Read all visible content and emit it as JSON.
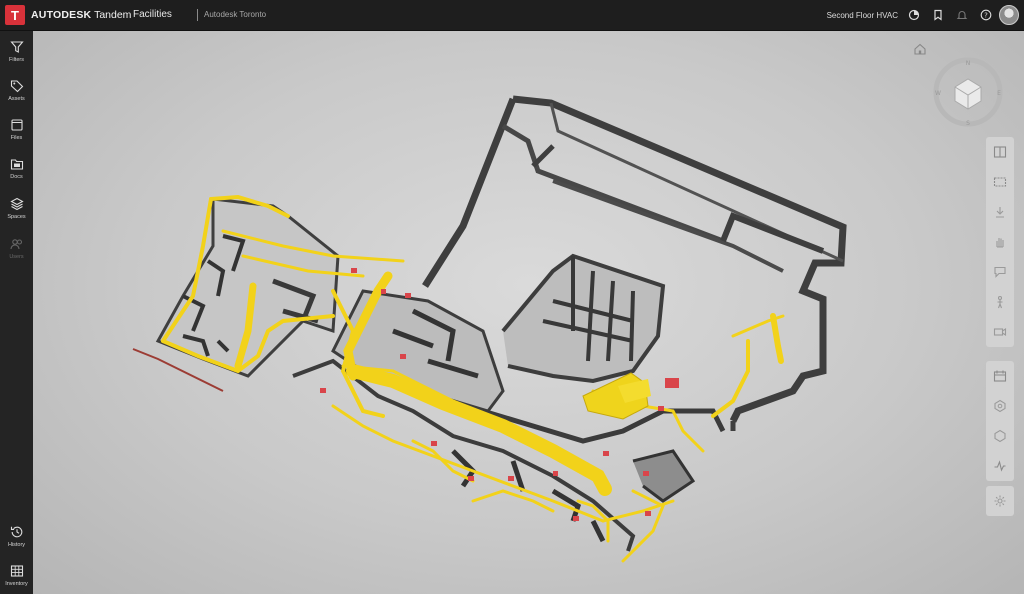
{
  "app": {
    "brand_bold": "AUTODESK",
    "brand_product": "Tandem",
    "logo_letter": "T",
    "module": "Facilities",
    "facility": "Autodesk Toronto",
    "view": "Second Floor HVAC"
  },
  "top_icons": [
    "view-icon",
    "bookmark-icon",
    "notifications-icon",
    "help-icon"
  ],
  "sidebar": {
    "items": [
      {
        "label": "Filters",
        "icon": "filter-icon"
      },
      {
        "label": "Assets",
        "icon": "tag-icon"
      },
      {
        "label": "Files",
        "icon": "folder-icon"
      },
      {
        "label": "Docs",
        "icon": "docs-icon"
      },
      {
        "label": "Spaces",
        "icon": "layers-icon"
      },
      {
        "label": "Users",
        "icon": "users-icon"
      }
    ],
    "bottom_items": [
      {
        "label": "History",
        "icon": "history-icon"
      },
      {
        "label": "Inventory",
        "icon": "table-icon"
      }
    ]
  },
  "viewcube": {
    "compass": [
      "N",
      "E",
      "S",
      "W"
    ]
  },
  "tools": {
    "group1": [
      "split-view-icon",
      "section-box-icon",
      "measure-icon",
      "pan-icon",
      "comment-icon",
      "person-icon",
      "camera-icon"
    ],
    "group2": [
      "calendar-icon",
      "settings-hex-icon",
      "asset-hex-icon",
      "activity-icon"
    ],
    "group3": [
      "gear-icon"
    ]
  },
  "colors": {
    "accent": "#d8323a",
    "duct": "#f2d21a",
    "walls": "#4a4a4a"
  }
}
